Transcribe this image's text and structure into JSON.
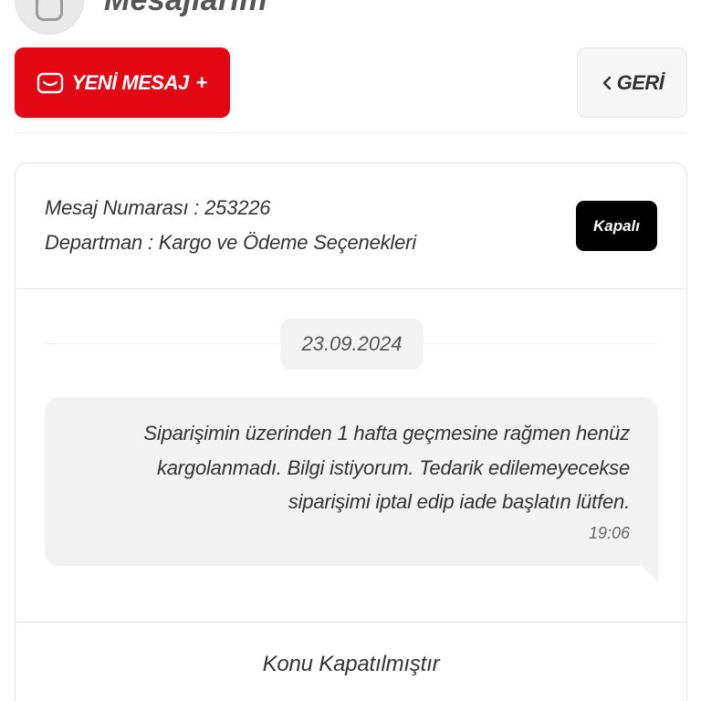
{
  "header": {
    "title": "Mesajlarım"
  },
  "actions": {
    "new_message_label": "YENİ MESAJ",
    "new_message_plus": "+",
    "back_label": "GERİ",
    "accent_color": "#e30613"
  },
  "message": {
    "number_line": "Mesaj Numarası : 253226",
    "department_line": "Departman : Kargo ve Ödeme Seçenekleri",
    "status": "Kapalı",
    "date": "23.09.2024",
    "body": "Siparişimin üzerinden 1 hafta geçmesine rağmen henüz kargolanmadı. Bilgi istiyorum. Tedarik edilemeyecekse siparişimi iptal edip iade başlatın lütfen.",
    "time": "19:06",
    "closed_notice": "Konu Kapatılmıştır"
  },
  "icons": {
    "new_message": "mail-icon",
    "back": "chevron-left-icon",
    "avatar": "avatar-icon"
  }
}
